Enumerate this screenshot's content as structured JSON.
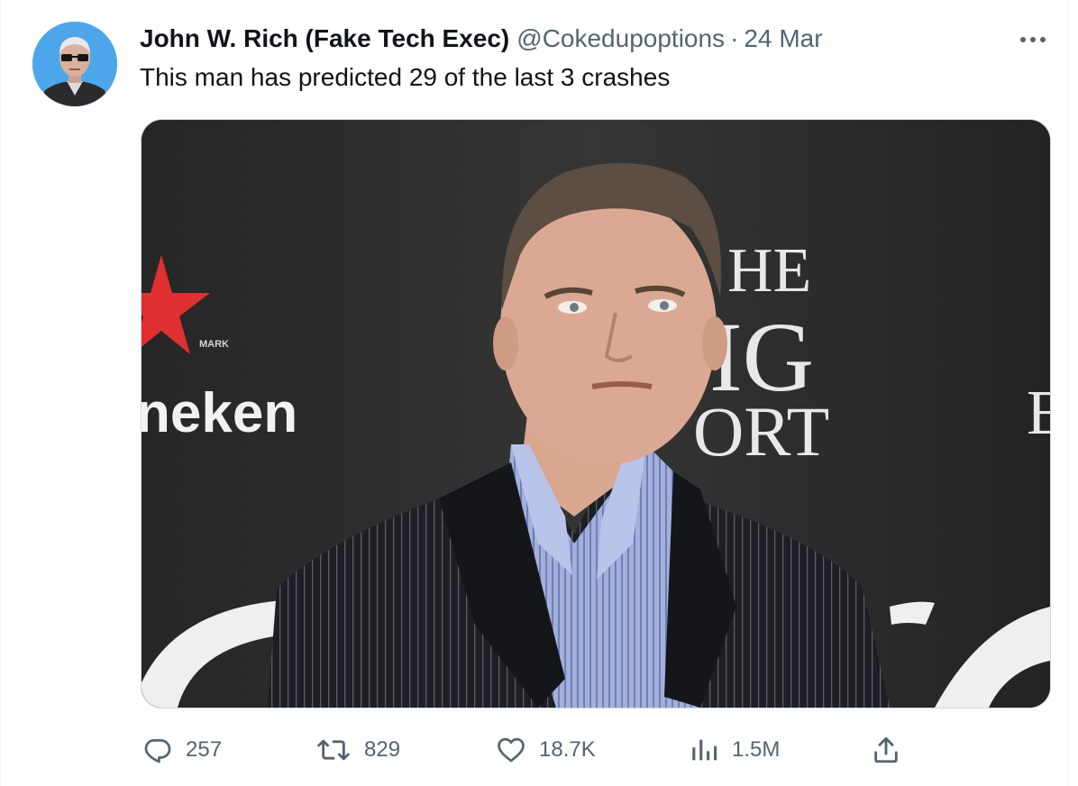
{
  "tweet": {
    "author_name": "John W. Rich (Fake Tech Exec)",
    "handle": "@Cokedupoptions",
    "separator": "·",
    "date": "24 Mar",
    "text": "This man has predicted 29 of the last 3 crashes"
  },
  "media": {
    "backdrop_fragments": {
      "brand_mark": "MARK",
      "brand_word": "neken",
      "title_line1": "HE",
      "title_line2": "IG",
      "title_line3": "ORT",
      "edge_letter": "E"
    }
  },
  "actions": {
    "reply": {
      "count": "257",
      "icon": "reply-icon"
    },
    "retweet": {
      "count": "829",
      "icon": "retweet-icon"
    },
    "like": {
      "count": "18.7K",
      "icon": "heart-icon"
    },
    "views": {
      "count": "1.5M",
      "icon": "views-icon"
    },
    "share": {
      "icon": "share-icon"
    }
  },
  "colors": {
    "text_primary": "#0f1419",
    "text_secondary": "#536471",
    "avatar_bg": "#4ea6ea",
    "border": "#cfd9de"
  }
}
